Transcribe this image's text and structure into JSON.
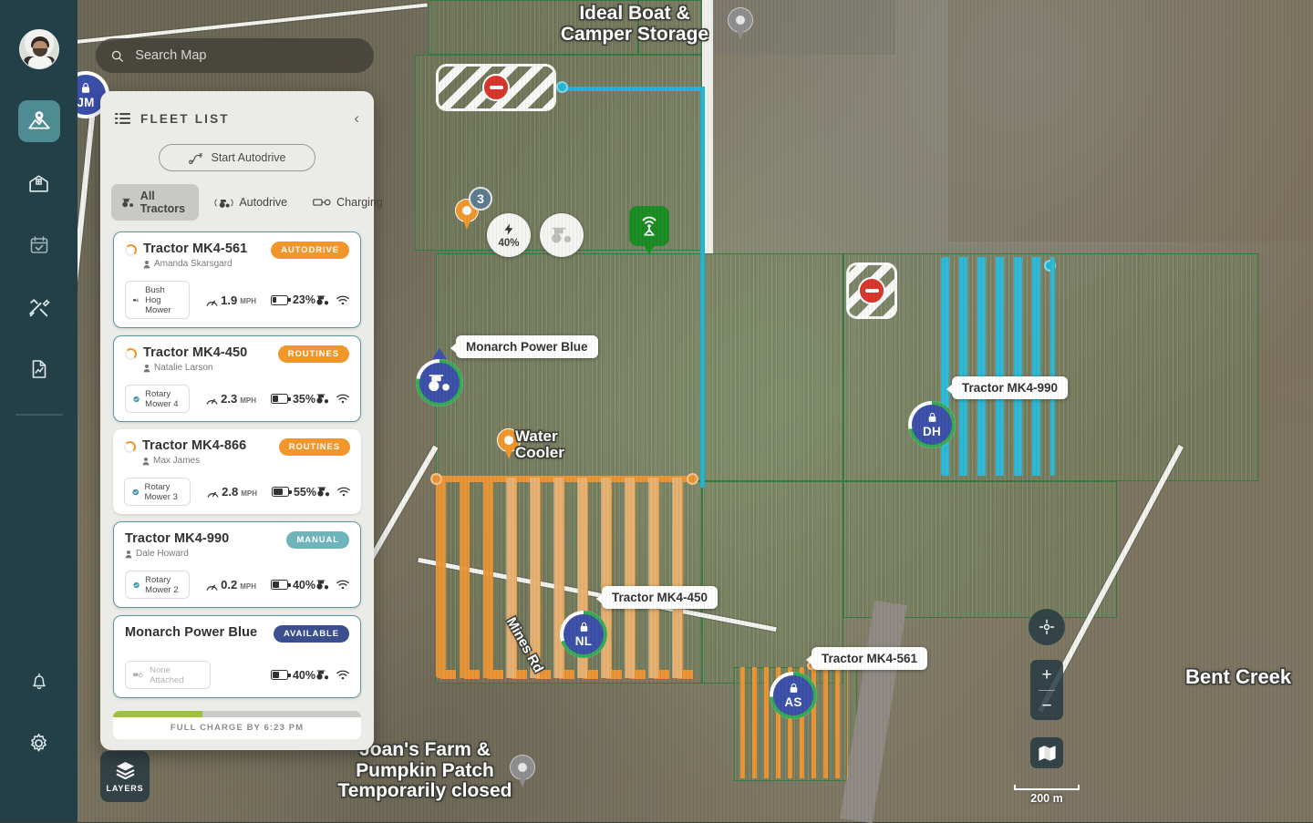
{
  "app": {
    "sidebar": {
      "avatar_name": "user-avatar",
      "items": [
        {
          "id": "map",
          "icon": "map-pin-icon",
          "label": "Map",
          "active": true
        },
        {
          "id": "barn",
          "icon": "barn-icon",
          "label": "Barn",
          "active": false
        },
        {
          "id": "schedule",
          "icon": "calendar-check-icon",
          "label": "Schedule",
          "active": false
        },
        {
          "id": "tools",
          "icon": "tools-icon",
          "label": "Maintenance",
          "active": false
        },
        {
          "id": "reports",
          "icon": "report-icon",
          "label": "Reports",
          "active": false
        }
      ],
      "bottom_items": [
        {
          "id": "notifications",
          "icon": "bell-icon",
          "label": "Notifications"
        },
        {
          "id": "settings",
          "icon": "gear-icon",
          "label": "Settings"
        }
      ]
    },
    "search": {
      "placeholder": "Search Map",
      "value": "",
      "icon": "search-icon"
    },
    "fleet_panel": {
      "title": "FLEET LIST",
      "list_icon": "list-icon",
      "collapse_icon": "chevron-left-icon",
      "start_autodrive_label": "Start Autodrive",
      "start_autodrive_icon": "autodrive-route-icon",
      "filters": [
        {
          "id": "all",
          "label": "All Tractors",
          "icon": "tractor-icon",
          "active": true
        },
        {
          "id": "autodrive",
          "label": "Autodrive",
          "icon": "autodrive-wave-icon",
          "active": false
        },
        {
          "id": "charging",
          "label": "Charging",
          "icon": "charging-plug-icon",
          "active": false
        }
      ],
      "tractors": [
        {
          "name": "Tractor MK4-561",
          "owner": "Amanda Skarsgard",
          "status": "AUTODRIVE",
          "status_type": "autodrive",
          "implement": "Bush Hog Mower",
          "implement_icon": "implement-icon",
          "speed": "1.9",
          "speed_unit": "MPH",
          "battery": "23%",
          "battery_level": 23,
          "selected": true,
          "spinner": true,
          "icons": [
            "tractor-icon",
            "wifi-icon"
          ]
        },
        {
          "name": "Tractor MK4-450",
          "owner": "Natalie Larson",
          "status": "ROUTINES",
          "status_type": "routines",
          "implement": "Rotary Mower 4",
          "implement_icon": "check-circle-icon",
          "speed": "2.3",
          "speed_unit": "MPH",
          "battery": "35%",
          "battery_level": 35,
          "selected": true,
          "spinner": true,
          "icons": [
            "tractor-icon",
            "wifi-icon"
          ]
        },
        {
          "name": "Tractor MK4-866",
          "owner": "Max James",
          "status": "ROUTINES",
          "status_type": "routines",
          "implement": "Rotary Mower 3",
          "implement_icon": "check-circle-icon",
          "speed": "2.8",
          "speed_unit": "MPH",
          "battery": "55%",
          "battery_level": 55,
          "selected": false,
          "spinner": true,
          "icons": [
            "tractor-icon",
            "wifi-icon"
          ]
        },
        {
          "name": "Tractor MK4-990",
          "owner": "Dale Howard",
          "status": "MANUAL",
          "status_type": "manual",
          "implement": "Rotary Mower 2",
          "implement_icon": "check-circle-icon",
          "speed": "0.2",
          "speed_unit": "MPH",
          "battery": "40%",
          "battery_level": 40,
          "selected": true,
          "spinner": false,
          "icons": [
            "tractor-icon",
            "wifi-icon"
          ]
        },
        {
          "name": "Monarch Power Blue",
          "owner": "",
          "status": "AVAILABLE",
          "status_type": "available",
          "implement": "None Attached",
          "implement_icon": "implement-icon",
          "speed": "",
          "speed_unit": "",
          "battery": "40%",
          "battery_level": 40,
          "selected": true,
          "spinner": false,
          "icons": [
            "tractor-icon",
            "wifi-icon"
          ]
        }
      ],
      "charge_status": {
        "label": "FULL CHARGE BY 6:23 PM",
        "percent": 36
      }
    },
    "map": {
      "pois": [
        {
          "id": "ideal-boat",
          "text": "Ideal Boat &\nCamper Storage",
          "type": "place"
        },
        {
          "id": "joans-farm",
          "text": "Joan's Farm &\nPumpkin Patch\nTemporarily closed",
          "type": "place"
        },
        {
          "id": "bent-creek",
          "text": "Bent Creek",
          "type": "place"
        },
        {
          "id": "mines-rd",
          "text": "Mines Rd",
          "type": "road"
        }
      ],
      "markers": [
        {
          "id": "water-cooler",
          "label": "Water\nCooler",
          "type": "orange-pin"
        },
        {
          "id": "cluster-3",
          "label": "3",
          "type": "cluster"
        },
        {
          "id": "charge-chip",
          "label": "40%",
          "type": "charge-chip",
          "icon": "bolt-icon"
        },
        {
          "id": "tractor-chip",
          "label": "",
          "type": "tractor-chip",
          "icon": "tractor-icon"
        },
        {
          "id": "base-station",
          "label": "",
          "type": "tower",
          "icon": "signal-tower-icon"
        }
      ],
      "tractor_markers": [
        {
          "id": "mpb",
          "initials": "",
          "callout": "Monarch Power Blue",
          "icon": "tractor-icon",
          "locked": false,
          "progress": 0.78
        },
        {
          "id": "mk4-990",
          "initials": "DH",
          "callout": "Tractor MK4-990",
          "icon": "lock-icon",
          "locked": true,
          "progress": 0.72
        },
        {
          "id": "mk4-450",
          "initials": "NL",
          "callout": "Tractor MK4-450",
          "icon": "lock-icon",
          "locked": true,
          "progress": 0.7
        },
        {
          "id": "mk4-561",
          "initials": "AS",
          "callout": "Tractor MK4-561",
          "icon": "lock-icon",
          "locked": true,
          "progress": 0.74
        }
      ],
      "hidden_marker": {
        "initials": "JM",
        "icon": "lock-icon"
      },
      "nogo_zones": 2,
      "controls": {
        "locate_icon": "crosshair-icon",
        "zoom_in": "+",
        "zoom_out": "−",
        "basemap_icon": "map-layers-icon",
        "scale_label": "200 m"
      },
      "layers_button": {
        "label": "LAYERS",
        "icon": "layers-icon"
      }
    },
    "colors": {
      "rail_bg": "#234049",
      "accent_teal": "#4f8b93",
      "orange": "#f0962a",
      "blue": "#3b4fa8",
      "manual_teal": "#6fb4bb",
      "available_navy": "#3b4f8f",
      "charge_green": "#9ec13c",
      "path_cyan": "#1fb6d4",
      "field_green": "#2f7a3f"
    }
  }
}
